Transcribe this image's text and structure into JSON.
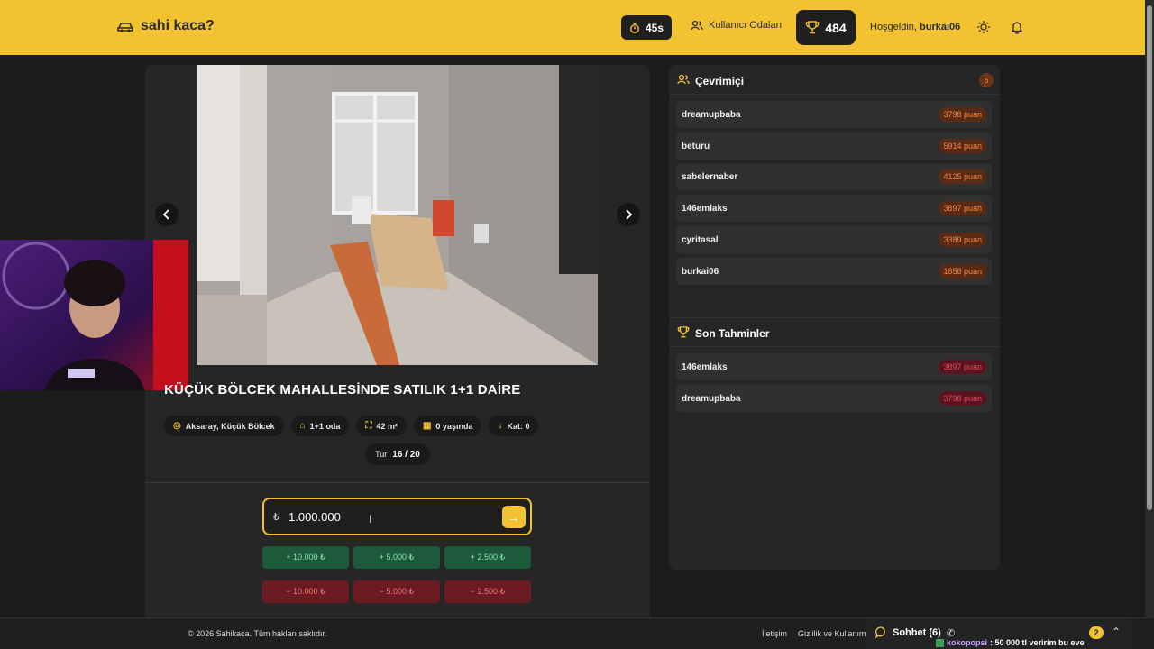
{
  "header": {
    "logo_text": "sahi kaca?",
    "timer": "45s",
    "rooms_label": "Kullanıcı Odaları",
    "score": "484",
    "greeting_prefix": "Hoşgeldin,",
    "username": "burkai06"
  },
  "listing": {
    "title": "KÜÇÜK BÖLCEK MAHALLESİNDE SATILIK 1+1 DAİRE",
    "location": "Aksaray, Küçük Bölcek",
    "rooms": "1+1 oda",
    "area": "42 m²",
    "age": "0 yaşında",
    "floor": "Kat: 0",
    "round_label": "Tur",
    "round_value": "16 / 20"
  },
  "guess": {
    "currency": "₺",
    "value": "1.000.000"
  },
  "adjust_buttons": [
    {
      "label": "+ 10.000 ₺",
      "type": "plus"
    },
    {
      "label": "+ 5.000 ₺",
      "type": "plus"
    },
    {
      "label": "+ 2.500 ₺",
      "type": "plus"
    },
    {
      "label": "− 10.000 ₺",
      "type": "minus"
    },
    {
      "label": "− 5.000 ₺",
      "type": "minus"
    },
    {
      "label": "− 2.500 ₺",
      "type": "minus"
    }
  ],
  "online": {
    "title": "Çevrimiçi",
    "count": "6",
    "users": [
      {
        "name": "dreamupbaba",
        "points": "3798 puan"
      },
      {
        "name": "beturu",
        "points": "5914 puan"
      },
      {
        "name": "sabelernaber",
        "points": "4125 puan"
      },
      {
        "name": "146emlaks",
        "points": "3897 puan"
      },
      {
        "name": "cyritasal",
        "points": "3389 puan"
      },
      {
        "name": "burkai06",
        "points": "1858 puan"
      }
    ]
  },
  "recent": {
    "title": "Son Tahminler",
    "items": [
      {
        "name": "146emlaks",
        "points": "3897 puan"
      },
      {
        "name": "dreamupbaba",
        "points": "3798 puan"
      }
    ]
  },
  "footer": {
    "copyright": "© 2026 Sahikaca. Tüm hakları saklıdır.",
    "contact": "İletişim",
    "privacy": "Gizlilik ve Kullanım",
    "chat_label": "Sohbet (6)",
    "chat_badge": "2",
    "ticker_user": "kokopopsi",
    "ticker_message": ": 50 000 tl verirím bu eve"
  },
  "colors": {
    "brand": "#f2c230",
    "panel": "#262626",
    "plus": "#1c5a3a",
    "minus": "#6b1c22"
  }
}
